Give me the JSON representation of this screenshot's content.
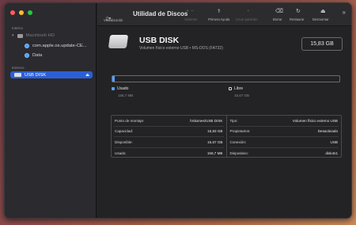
{
  "window": {
    "title": "Utilidad de Discos"
  },
  "sidebar": {
    "internal_label": "Interno",
    "internal_disk": "Macintosh HD",
    "internal_volume": "com.apple.os.update-CE...",
    "data_volume": "Data",
    "external_label": "Externo",
    "external_disk": "USB DISK"
  },
  "toolbar": {
    "view_label": "Visualización",
    "volume_label": "Volumen",
    "first_aid_label": "Primera Ayuda",
    "partition_label": "Crear partición",
    "erase_label": "Borrar",
    "restore_label": "Restaurar",
    "unmount_label": "Desmontar"
  },
  "disk": {
    "name": "USB DISK",
    "description": "Volumen físico externo USB • MS-DOS (FAT32)",
    "size": "15,83 GB",
    "used_label": "Usado",
    "used_value": "158,7 MB",
    "free_label": "Libre",
    "free_value": "15,67 GB",
    "used_fraction": 0.01
  },
  "info": {
    "left": [
      {
        "k": "Punto de montaje:",
        "v": "/Volumes/USB DISK"
      },
      {
        "k": "Capacidad:",
        "v": "15,83 GB"
      },
      {
        "k": "Disponible:",
        "v": "15,67 GB"
      },
      {
        "k": "Usado:",
        "v": "158,7 MB"
      }
    ],
    "right": [
      {
        "k": "Tipo:",
        "v": "Volumen físico externo USB"
      },
      {
        "k": "Propietarios:",
        "v": "Desactivado"
      },
      {
        "k": "Conexión:",
        "v": "USB"
      },
      {
        "k": "Dispositivo:",
        "v": "disk4s1"
      }
    ]
  },
  "colors": {
    "accent": "#2b5fd8",
    "used": "#5aa0ff",
    "free": "#ffffff"
  }
}
